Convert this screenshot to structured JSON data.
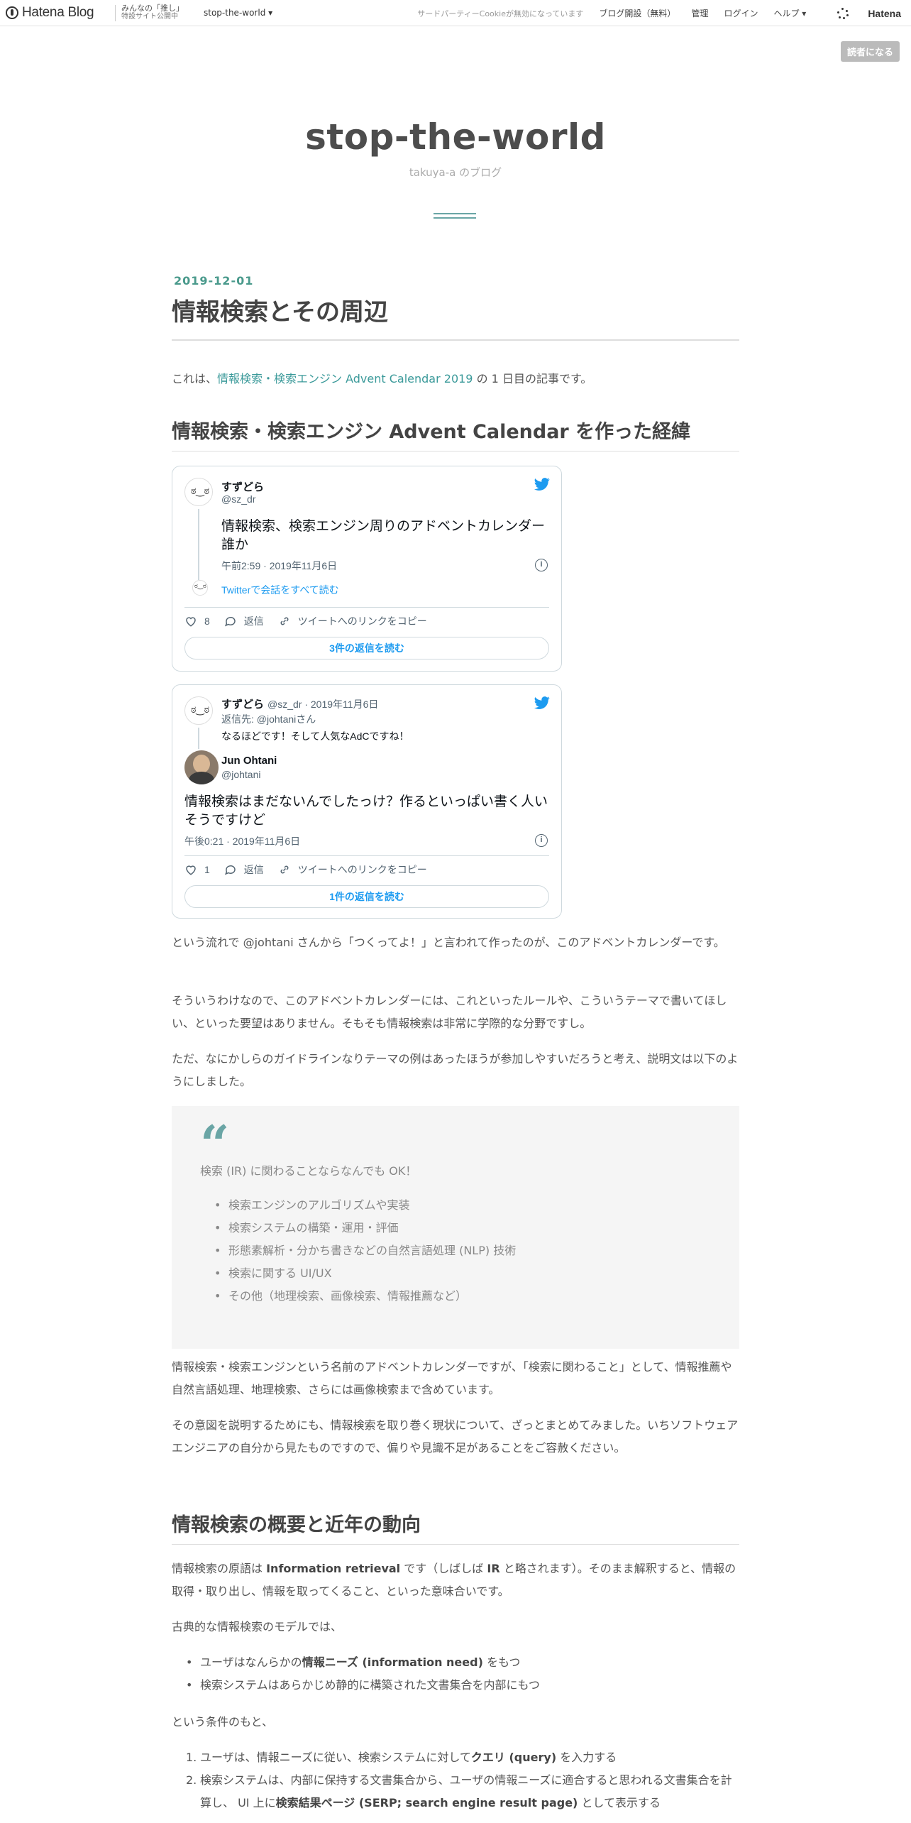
{
  "topbar": {
    "logo_text": "Hatena Blog",
    "promo_line1": "みんなの「推し」",
    "promo_line2": "特設サイト公開中",
    "blog_selector": "stop-the-world ▾",
    "cookie_notice": "サードパーティーCookieが無効になっています",
    "start_blog": "ブログ開設（無料）",
    "admin": "管理",
    "login": "ログイン",
    "help": "ヘルプ ▾",
    "hatena": "Hatena"
  },
  "reader_button": "読者になる",
  "blog": {
    "title": "stop-the-world",
    "description": "takuya-a のブログ"
  },
  "article": {
    "date": "2019-12-01",
    "title": "情報検索とその周辺",
    "intro_prefix": "これは、",
    "intro_link": "情報検索・検索エンジン Advent Calendar 2019",
    "intro_suffix": " の 1 日目の記事です。",
    "h3_calendar": "情報検索・検索エンジン Advent Calendar を作った経緯",
    "para_flow": "という流れで @johtani さんから「つくってよ！」と言われて作ったのが、このアドベントカレンダーです。",
    "para_rules": "そういうわけなので、このアドベントカレンダーには、これといったルールや、こういうテーマで書いてほしい、といった要望はありません。そもそも情報検索は非常に学際的な分野ですし。",
    "para_guideline": "ただ、なにかしらのガイドラインなりテーマの例はあったほうが参加しやすいだろうと考え、説明文は以下のようにしました。",
    "quote_text": "検索 (IR) に関わることならなんでも OK！",
    "quote_items": [
      "検索エンジンのアルゴリズムや実装",
      "検索システムの構築・運用・評価",
      "形態素解析・分かち書きなどの自然言語処理 (NLP) 技術",
      "検索に関する UI/UX",
      "その他（地理検索、画像検索、情報推薦など）"
    ],
    "para_name": "情報検索・検索エンジンという名前のアドベントカレンダーですが、「検索に関わること」として、情報推薦や自然言語処理、地理検索、さらには画像検索まで含めています。",
    "para_intent": "その意図を説明するためにも、情報検索を取り巻く現状について、ざっとまとめてみました。いちソフトウェアエンジニアの自分から見たものですので、偏りや見識不足があることをご容赦ください。",
    "h3_overview": "情報検索の概要と近年の動向",
    "para_ir_1": "情報検索の原語は ",
    "para_ir_bold1": "Information retrieval",
    "para_ir_2": " です（しばしば ",
    "para_ir_bold2": "IR",
    "para_ir_3": " と略されます）。そのまま解釈すると、情報の取得・取り出し、情報を取ってくること、といった意味合いです。",
    "para_model": "古典的な情報検索のモデルでは、",
    "ul_item1_pre": "ユーザはなんらかの",
    "ul_item1_bold": "情報ニーズ (information need)",
    "ul_item1_post": " をもつ",
    "ul_item2": "検索システムはあらかじめ静的に構築された文書集合を内部にもつ",
    "para_condition": "という条件のもと、",
    "ol_item1_num": "1.",
    "ol_item1_pre": "ユーザは、情報ニーズに従い、検索システムに対して",
    "ol_item1_bold": "クエリ (query)",
    "ol_item1_post": " を入力する",
    "ol_item2_num": "2.",
    "ol_item2_pre": "検索システムは、内部に保持する文書集合から、ユーザの情報ニーズに適合すると思われる文書集合を計算し、 UI 上に",
    "ol_item2_bold": "検索結果ページ (SERP; search engine result page)",
    "ol_item2_post": " として表示する"
  },
  "tweet1": {
    "name": "すずどら",
    "handle": "@sz_dr",
    "text": "情報検索、検索エンジン周りのアドベントカレンダー誰か",
    "time": "午前2:59 · 2019年11月6日",
    "conversation_link": "Twitterで会話をすべて読む",
    "likes": "8",
    "reply": "返信",
    "copy_link": "ツイートへのリンクをコピー",
    "read_replies": "3件の返信を読む"
  },
  "tweet2": {
    "quoted_name": "すずどら",
    "quoted_meta": "@sz_dr · 2019年11月6日",
    "reply_to": "返信先: @johtaniさん",
    "quoted_text": "なるほどです！そして人気なAdCですね！",
    "name": "Jun Ohtani",
    "handle": "@johtani",
    "text": "情報検索はまだないんでしたっけ？作るといっぱい書く人いそうですけど",
    "time": "午後0:21 · 2019年11月6日",
    "likes": "1",
    "reply": "返信",
    "copy_link": "ツイートへのリンクをコピー",
    "read_replies": "1件の返信を読む"
  },
  "colors": {
    "accent": "#3b9a9a",
    "twitter_blue": "#1d9bf0",
    "date_green": "#4a9a8c"
  }
}
